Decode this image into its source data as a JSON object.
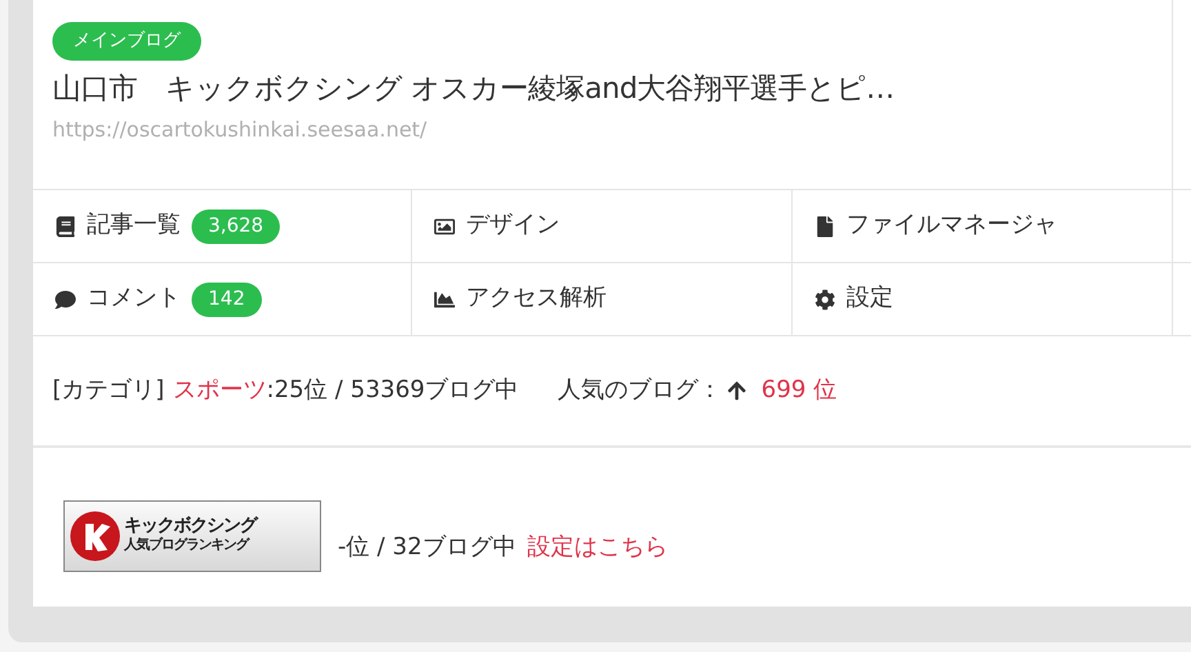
{
  "badge": "メインブログ",
  "blog_title": "山口市　キックボクシング オスカー綾塚and大谷翔平選手とピ…",
  "blog_url": "https://oscartokushinkai.seesaa.net/",
  "menu": [
    {
      "kind": "book",
      "label": "記事一覧",
      "count": "3,628"
    },
    {
      "kind": "image",
      "label": "デザイン"
    },
    {
      "kind": "file",
      "label": "ファイルマネージャ"
    },
    {
      "kind": "comment",
      "label": "コメント",
      "count": "142"
    },
    {
      "kind": "chart",
      "label": "アクセス解析"
    },
    {
      "kind": "gear",
      "label": "設定"
    }
  ],
  "category": {
    "prefix": "[カテゴリ]",
    "name": "スポーツ",
    "rank": ":25位 / 53369ブログ中",
    "popular_label": "人気のブログ：",
    "popular_rank": "699 位"
  },
  "ranking": {
    "banner_title": "キックボクシング",
    "banner_subtitle": "人気ブログランキング",
    "rank": "-位 / 32ブログ中",
    "settings_link": "設定はこちら"
  }
}
